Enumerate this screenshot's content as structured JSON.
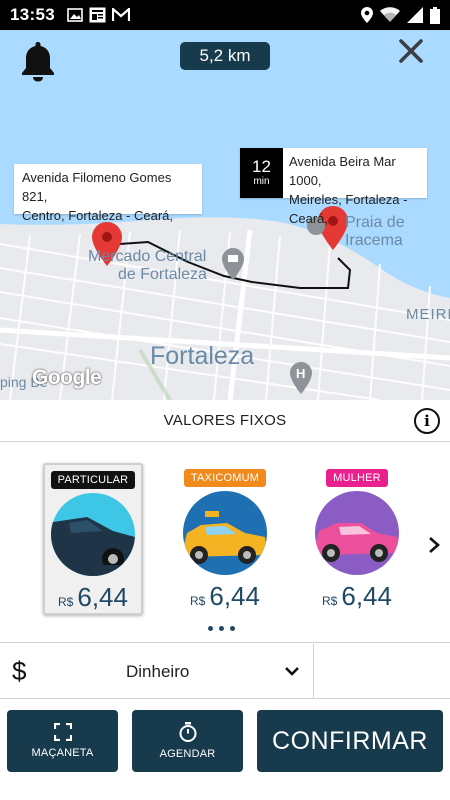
{
  "status_bar": {
    "time": "13:53",
    "notification_icons": [
      "image-icon",
      "news-icon",
      "gmail-icon"
    ],
    "system_icons": [
      "location-icon",
      "wifi-icon",
      "signal-icon",
      "battery-icon"
    ]
  },
  "map": {
    "distance": "5,2 km",
    "origin_address": "Avenida Filomeno Gomes 821,\nCentro, Fortaleza - Ceará,",
    "destination_eta_value": "12",
    "destination_eta_unit": "min",
    "destination_address": "Avenida Beira Mar 1000,\nMeireles, Fortaleza - Ceará,",
    "labels": {
      "mercado_line1": "Mercado Central",
      "mercado_line2": "de Fortaleza",
      "praia_line1": "Praia de",
      "praia_line2": "Iracema",
      "meireles": "MEIRE",
      "city": "Fortaleza",
      "shopping": "ping Be",
      "google": "Google"
    },
    "colors": {
      "water": "#aadaff",
      "land": "#e8eaed",
      "route": "#111111",
      "pin": "#e53935"
    }
  },
  "panel": {
    "title": "VALORES FIXOS",
    "options": [
      {
        "badge": "PARTICULAR",
        "badge_color": "#111111",
        "car_color": "#1f3447",
        "circle_color": "#3ec6e6",
        "currency": "R$",
        "value": "6,44",
        "selected": true
      },
      {
        "badge": "TAXICOMUM",
        "badge_color": "#f08a1c",
        "car_color": "#f3b323",
        "circle_color": "#1f6fb3",
        "currency": "R$",
        "value": "6,44",
        "selected": false
      },
      {
        "badge": "MULHER",
        "badge_color": "#ec1f8f",
        "car_color": "#ec4f9c",
        "circle_color": "#8b5cc4",
        "currency": "R$",
        "value": "6,44",
        "selected": false
      }
    ]
  },
  "payment": {
    "symbol": "$",
    "method": "Dinheiro"
  },
  "actions": {
    "macaneta": "MAÇANETA",
    "agendar": "AGENDAR",
    "confirmar": "CONFIRMAR"
  }
}
